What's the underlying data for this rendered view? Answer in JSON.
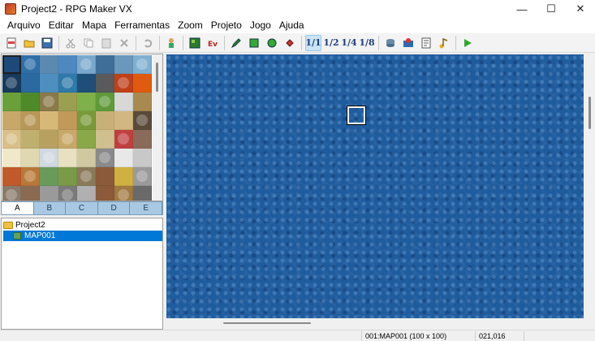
{
  "window": {
    "title": "Project2 - RPG Maker VX",
    "controls": [
      "—",
      "☐",
      "✕"
    ]
  },
  "menu": [
    "Arquivo",
    "Editar",
    "Mapa",
    "Ferramentas",
    "Zoom",
    "Projeto",
    "Jogo",
    "Ajuda"
  ],
  "toolbar": {
    "zoom_labels": [
      "1/1",
      "1/2",
      "1/4",
      "1/8"
    ]
  },
  "tileset": {
    "tabs": [
      "A",
      "B",
      "C",
      "D",
      "E"
    ],
    "active_tab": "A"
  },
  "maptree": {
    "project": "Project2",
    "maps": [
      "MAP001"
    ]
  },
  "status": {
    "map": "001:MAP001 (100 x 100)",
    "coords": "021,016"
  },
  "colors": {
    "water": "#1f5c9e",
    "selection": "#0078d7"
  }
}
